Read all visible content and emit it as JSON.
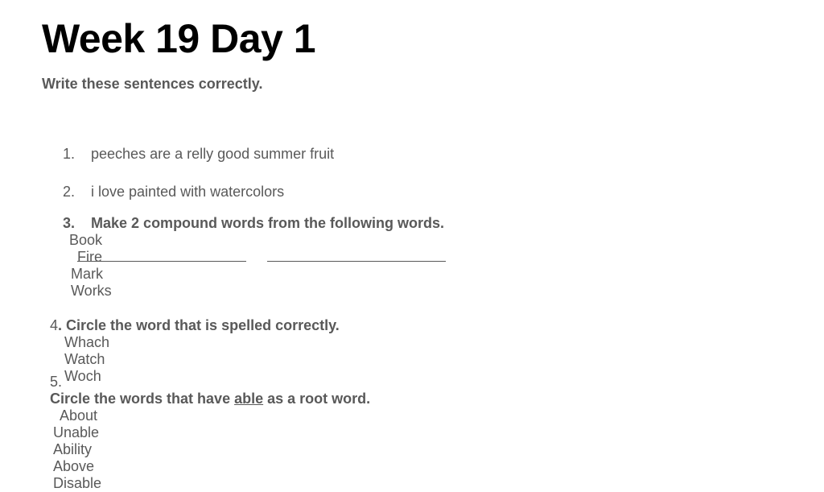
{
  "title": "Week 19 Day 1",
  "subtitle": "Write these sentences correctly.",
  "items": [
    {
      "number": "1.",
      "text": "peeches are a relly good summer fruit"
    },
    {
      "number": "2.",
      "text": "i love painted with watercolors"
    },
    {
      "number": "3.",
      "prompt": "Make 2 compound words from the following words.",
      "options": [
        "Book",
        "Fire",
        "Mark",
        "Works"
      ]
    },
    {
      "number": "4",
      "prompt": ". Circle the word that is spelled correctly.",
      "options": [
        "Whach",
        "Watch",
        "Woch"
      ]
    },
    {
      "number": "5.",
      "prompt_before": "Circle the words that have ",
      "prompt_underlined": "able",
      "prompt_after": " as a root word.",
      "options": [
        "About",
        "Unable",
        "Ability",
        "Above",
        "Disable"
      ]
    }
  ],
  "answer_blanks": 2
}
